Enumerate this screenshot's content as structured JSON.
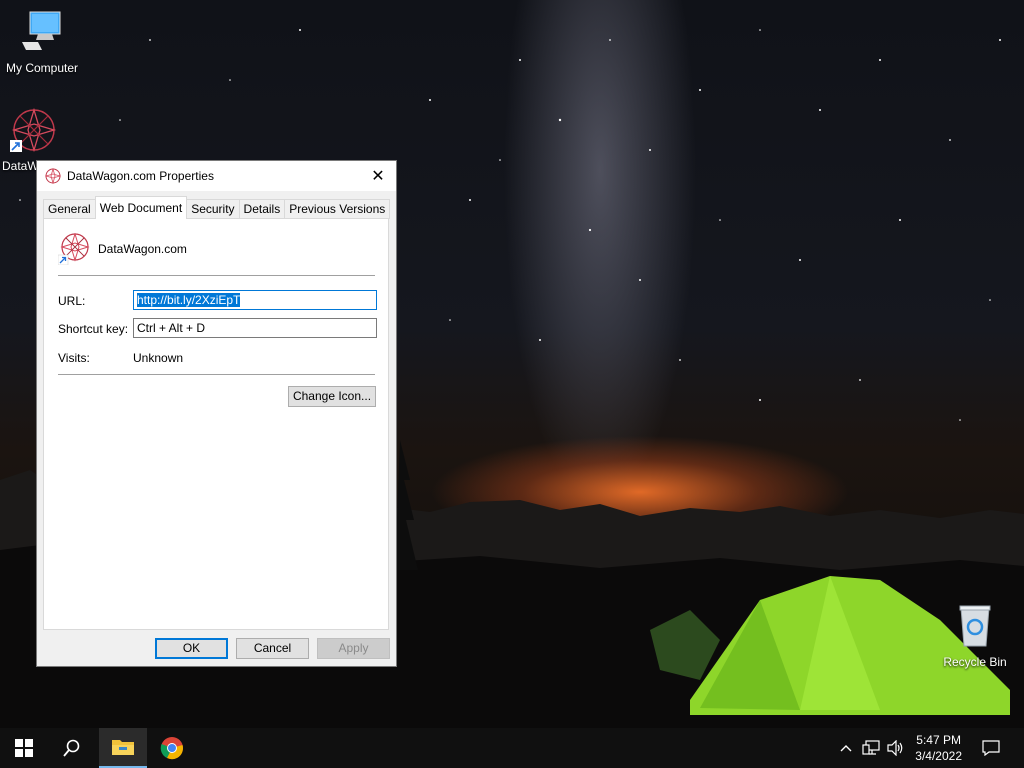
{
  "desktop": {
    "icons": [
      {
        "label": "My Computer"
      },
      {
        "label": "DataW"
      },
      {
        "label": "Recycle Bin"
      }
    ]
  },
  "dialog": {
    "title": "DataWagon.com Properties",
    "close_glyph": "✕",
    "tabs": [
      {
        "label": "General"
      },
      {
        "label": "Web Document"
      },
      {
        "label": "Security"
      },
      {
        "label": "Details"
      },
      {
        "label": "Previous Versions"
      }
    ],
    "active_tab": "Web Document",
    "shortcut_name": "DataWagon.com",
    "url_label": "URL:",
    "url_value": "http://bit.ly/2XziEpT",
    "shortcut_key_label": "Shortcut key:",
    "shortcut_key_value": "Ctrl + Alt + D",
    "visits_label": "Visits:",
    "visits_value": "Unknown",
    "change_icon_label": "Change Icon...",
    "ok_label": "OK",
    "cancel_label": "Cancel",
    "apply_label": "Apply"
  },
  "taskbar": {
    "time": "5:47 PM",
    "date": "3/4/2022"
  },
  "colors": {
    "accent": "#0078d7",
    "taskbar": "#101010",
    "dialog_bg": "#f0f0f0"
  }
}
